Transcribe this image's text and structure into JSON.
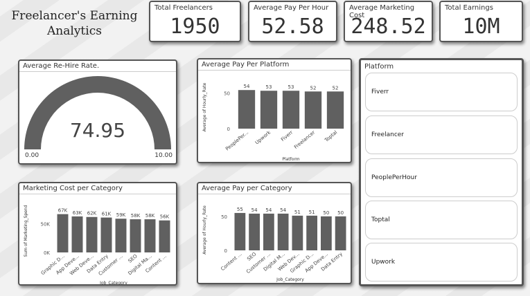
{
  "dashboard": {
    "title": "Freelancer's Earning Analytics"
  },
  "kpis": [
    {
      "label": "Total Freelancers",
      "value": "1950"
    },
    {
      "label": "Average Pay Per Hour",
      "value": "52.58"
    },
    {
      "label": "Average Marketing Cost",
      "value": "248.52"
    },
    {
      "label": "Total Earnings",
      "value": "10M"
    }
  ],
  "gauge": {
    "title": "Average Re-Hire Rate.",
    "value": "74.95",
    "min": "0.00",
    "max": "10.00",
    "fill_fraction": 1.0
  },
  "slicer": {
    "title": "Platform",
    "items": [
      "Fiverr",
      "Freelancer",
      "PeoplePerHour",
      "Toptal",
      "Upwork"
    ]
  },
  "colors": {
    "bar": "#606060",
    "gauge": "#606060",
    "border": "#555555"
  },
  "chart_data": [
    {
      "id": "pay_per_platform",
      "type": "bar",
      "title": "Average Pay Per Platform",
      "xlabel": "Platform",
      "ylabel": "Average of Hourly_Rate",
      "categories": [
        "PeoplePer...",
        "Upwork",
        "Fiverr",
        "Freelancer",
        "Toptal"
      ],
      "values": [
        54,
        53,
        53,
        52,
        52
      ],
      "data_labels": [
        "54",
        "53",
        "53",
        "52",
        "52"
      ],
      "yticks": [
        0,
        50
      ],
      "ylim": [
        0,
        60
      ]
    },
    {
      "id": "marketing_per_category",
      "type": "bar",
      "title": "Marketing Cost per Category",
      "xlabel": "Job_Category",
      "ylabel": "Sum of Marketing_Spend",
      "categories": [
        "Graphic D...",
        "App Deve...",
        "Web Deve...",
        "Data Entry",
        "Customer ...",
        "SEO",
        "Digital Ma...",
        "Content ..."
      ],
      "values": [
        67000,
        63000,
        62000,
        61000,
        59000,
        58000,
        58000,
        56000
      ],
      "data_labels": [
        "67K",
        "63K",
        "62K",
        "61K",
        "59K",
        "58K",
        "58K",
        "56K"
      ],
      "yticks": [
        0,
        50000
      ],
      "ytick_labels": [
        "0K",
        "50K"
      ],
      "ylim": [
        0,
        75000
      ]
    },
    {
      "id": "pay_per_category",
      "type": "bar",
      "title": "Average Pay per Category",
      "xlabel": "Job_Category",
      "ylabel": "Average of Hourly_Rate",
      "categories": [
        "Content ...",
        "SEO",
        "Customer ...",
        "Digital M...",
        "Web Dev...",
        "Graphic D...",
        "App Deve...",
        "Data Entry"
      ],
      "values": [
        55,
        54,
        54,
        54,
        51,
        51,
        50,
        50
      ],
      "data_labels": [
        "55",
        "54",
        "54",
        "54",
        "51",
        "51",
        "50",
        "50"
      ],
      "yticks": [
        0,
        50
      ],
      "ylim": [
        0,
        60
      ]
    }
  ]
}
